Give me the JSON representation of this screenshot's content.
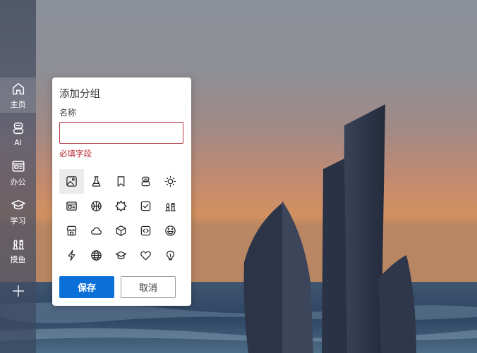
{
  "colors": {
    "accent": "#0a6fd6",
    "error": "#b8272f",
    "input_border_error": "#b33a45",
    "sidebar_text": "#ffffff"
  },
  "sidebar": {
    "items": [
      {
        "label": "主页",
        "icon": "home-icon",
        "active": true
      },
      {
        "label": "AI",
        "icon": "robot-icon",
        "active": false
      },
      {
        "label": "办公",
        "icon": "office-card-icon",
        "active": false
      },
      {
        "label": "学习",
        "icon": "graduation-cap-icon",
        "active": false
      },
      {
        "label": "摸鱼",
        "icon": "chess-icon",
        "active": false
      }
    ],
    "add_icon": "plus-icon"
  },
  "dialog": {
    "title": "添加分组",
    "name_label": "名称",
    "name_value": "",
    "name_placeholder": "",
    "error_text": "必填字段",
    "icons": [
      "image-icon",
      "flask-icon",
      "bookmark-icon",
      "robot-icon",
      "sun-icon",
      "news-icon",
      "basketball-icon",
      "badge-star-icon",
      "checkbox-icon",
      "chess-icon",
      "store-icon",
      "cloud-icon",
      "cube-icon",
      "code-icon",
      "laugh-icon",
      "lightning-icon",
      "globe-icon",
      "graduation-cap-icon",
      "heart-icon",
      "lightbulb-icon"
    ],
    "selected_icon": "image-icon",
    "save_label": "保存",
    "cancel_label": "取消"
  }
}
